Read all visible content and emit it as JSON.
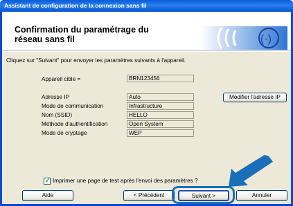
{
  "window": {
    "title": "Assistant de configuration de la connexion sans fil"
  },
  "header": {
    "title_line1": "Confirmation du paramétrage du",
    "title_line2": "réseau sans fil"
  },
  "instruction": "Cliquez sur \"Suivant\" pour envoyer les paramètres suivants à l'appareil.",
  "device": {
    "label": "Appareil cible =",
    "value": "BRN123456"
  },
  "settings": [
    {
      "label": "Adresse IP",
      "value": "Auto"
    },
    {
      "label": "Mode de communication",
      "value": "Infrastructure"
    },
    {
      "label": "Nom (SSID)",
      "value": "HELLO"
    },
    {
      "label": "Méthode d'authentification",
      "value": "Open System"
    },
    {
      "label": "Mode de cryptage",
      "value": "WEP"
    }
  ],
  "modify_ip_button": "Modifier l'adresse IP",
  "test_page": {
    "checked": true,
    "label": "Imprimer une page de test après l'envoi des paramètres ?"
  },
  "buttons": {
    "help": "Aide",
    "previous": "< Précédent",
    "next": "Suivant >",
    "cancel": "Annuler"
  },
  "colors": {
    "titlebar": "#0a5bd8",
    "panel": "#ece9d8",
    "highlight": "#1a6fb8"
  },
  "icons": [
    "wifi-logo-icon",
    "arrow-icon",
    "checkbox-check-icon"
  ]
}
